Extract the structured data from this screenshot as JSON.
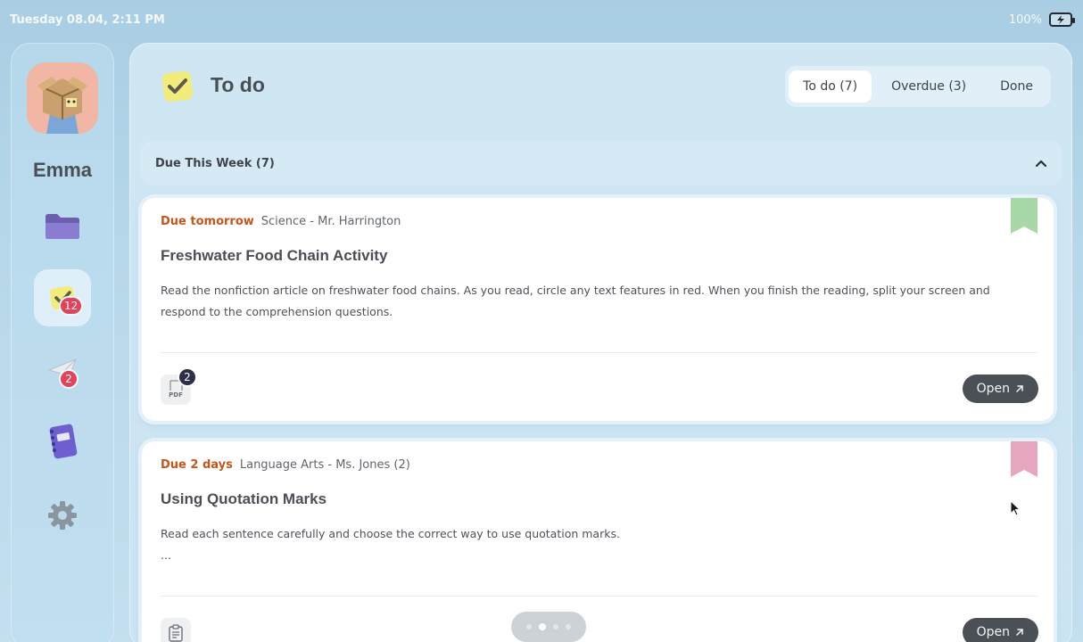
{
  "status_bar": {
    "datetime": "Tuesday 08.04, 2:11 PM",
    "battery": "100%"
  },
  "sidebar": {
    "user_name": "Emma",
    "items": [
      {
        "name": "folder",
        "icon": "folder-icon",
        "badge": ""
      },
      {
        "name": "todo",
        "icon": "check-note-icon",
        "badge": "12",
        "active": true
      },
      {
        "name": "messages",
        "icon": "paper-plane-icon",
        "badge": "2"
      },
      {
        "name": "notebook",
        "icon": "notebook-icon",
        "badge": ""
      },
      {
        "name": "settings",
        "icon": "gear-icon",
        "badge": ""
      }
    ]
  },
  "header": {
    "title": "To do",
    "tabs": [
      {
        "label": "To do (7)",
        "active": true
      },
      {
        "label": "Overdue (3)",
        "active": false
      },
      {
        "label": "Done",
        "active": false
      }
    ]
  },
  "section": {
    "title": "Due This Week (7)"
  },
  "cards": [
    {
      "due": "Due tomorrow",
      "course": "Science - Mr. Harrington",
      "title": "Freshwater Food Chain Activity",
      "description": "Read the nonfiction article on freshwater food chains. As you read, circle any text features in red. When you finish the reading, split your screen and respond to the comprehension questions.",
      "attachment_label": "PDF",
      "attachment_count": "2",
      "open_label": "Open",
      "bookmark_color": "#a8d8a8"
    },
    {
      "due": "Due 2 days",
      "course": "Language Arts - Ms. Jones (2)",
      "title": "Using Quotation Marks",
      "description": "Read each sentence carefully and choose the correct way to use quotation marks.",
      "description_more": "...",
      "open_label": "Open",
      "bookmark_color": "#e6a6c0"
    }
  ],
  "colors": {
    "accent_due": "#c4561c",
    "badge_red": "#e0435a",
    "button_dark": "#4b5056"
  }
}
